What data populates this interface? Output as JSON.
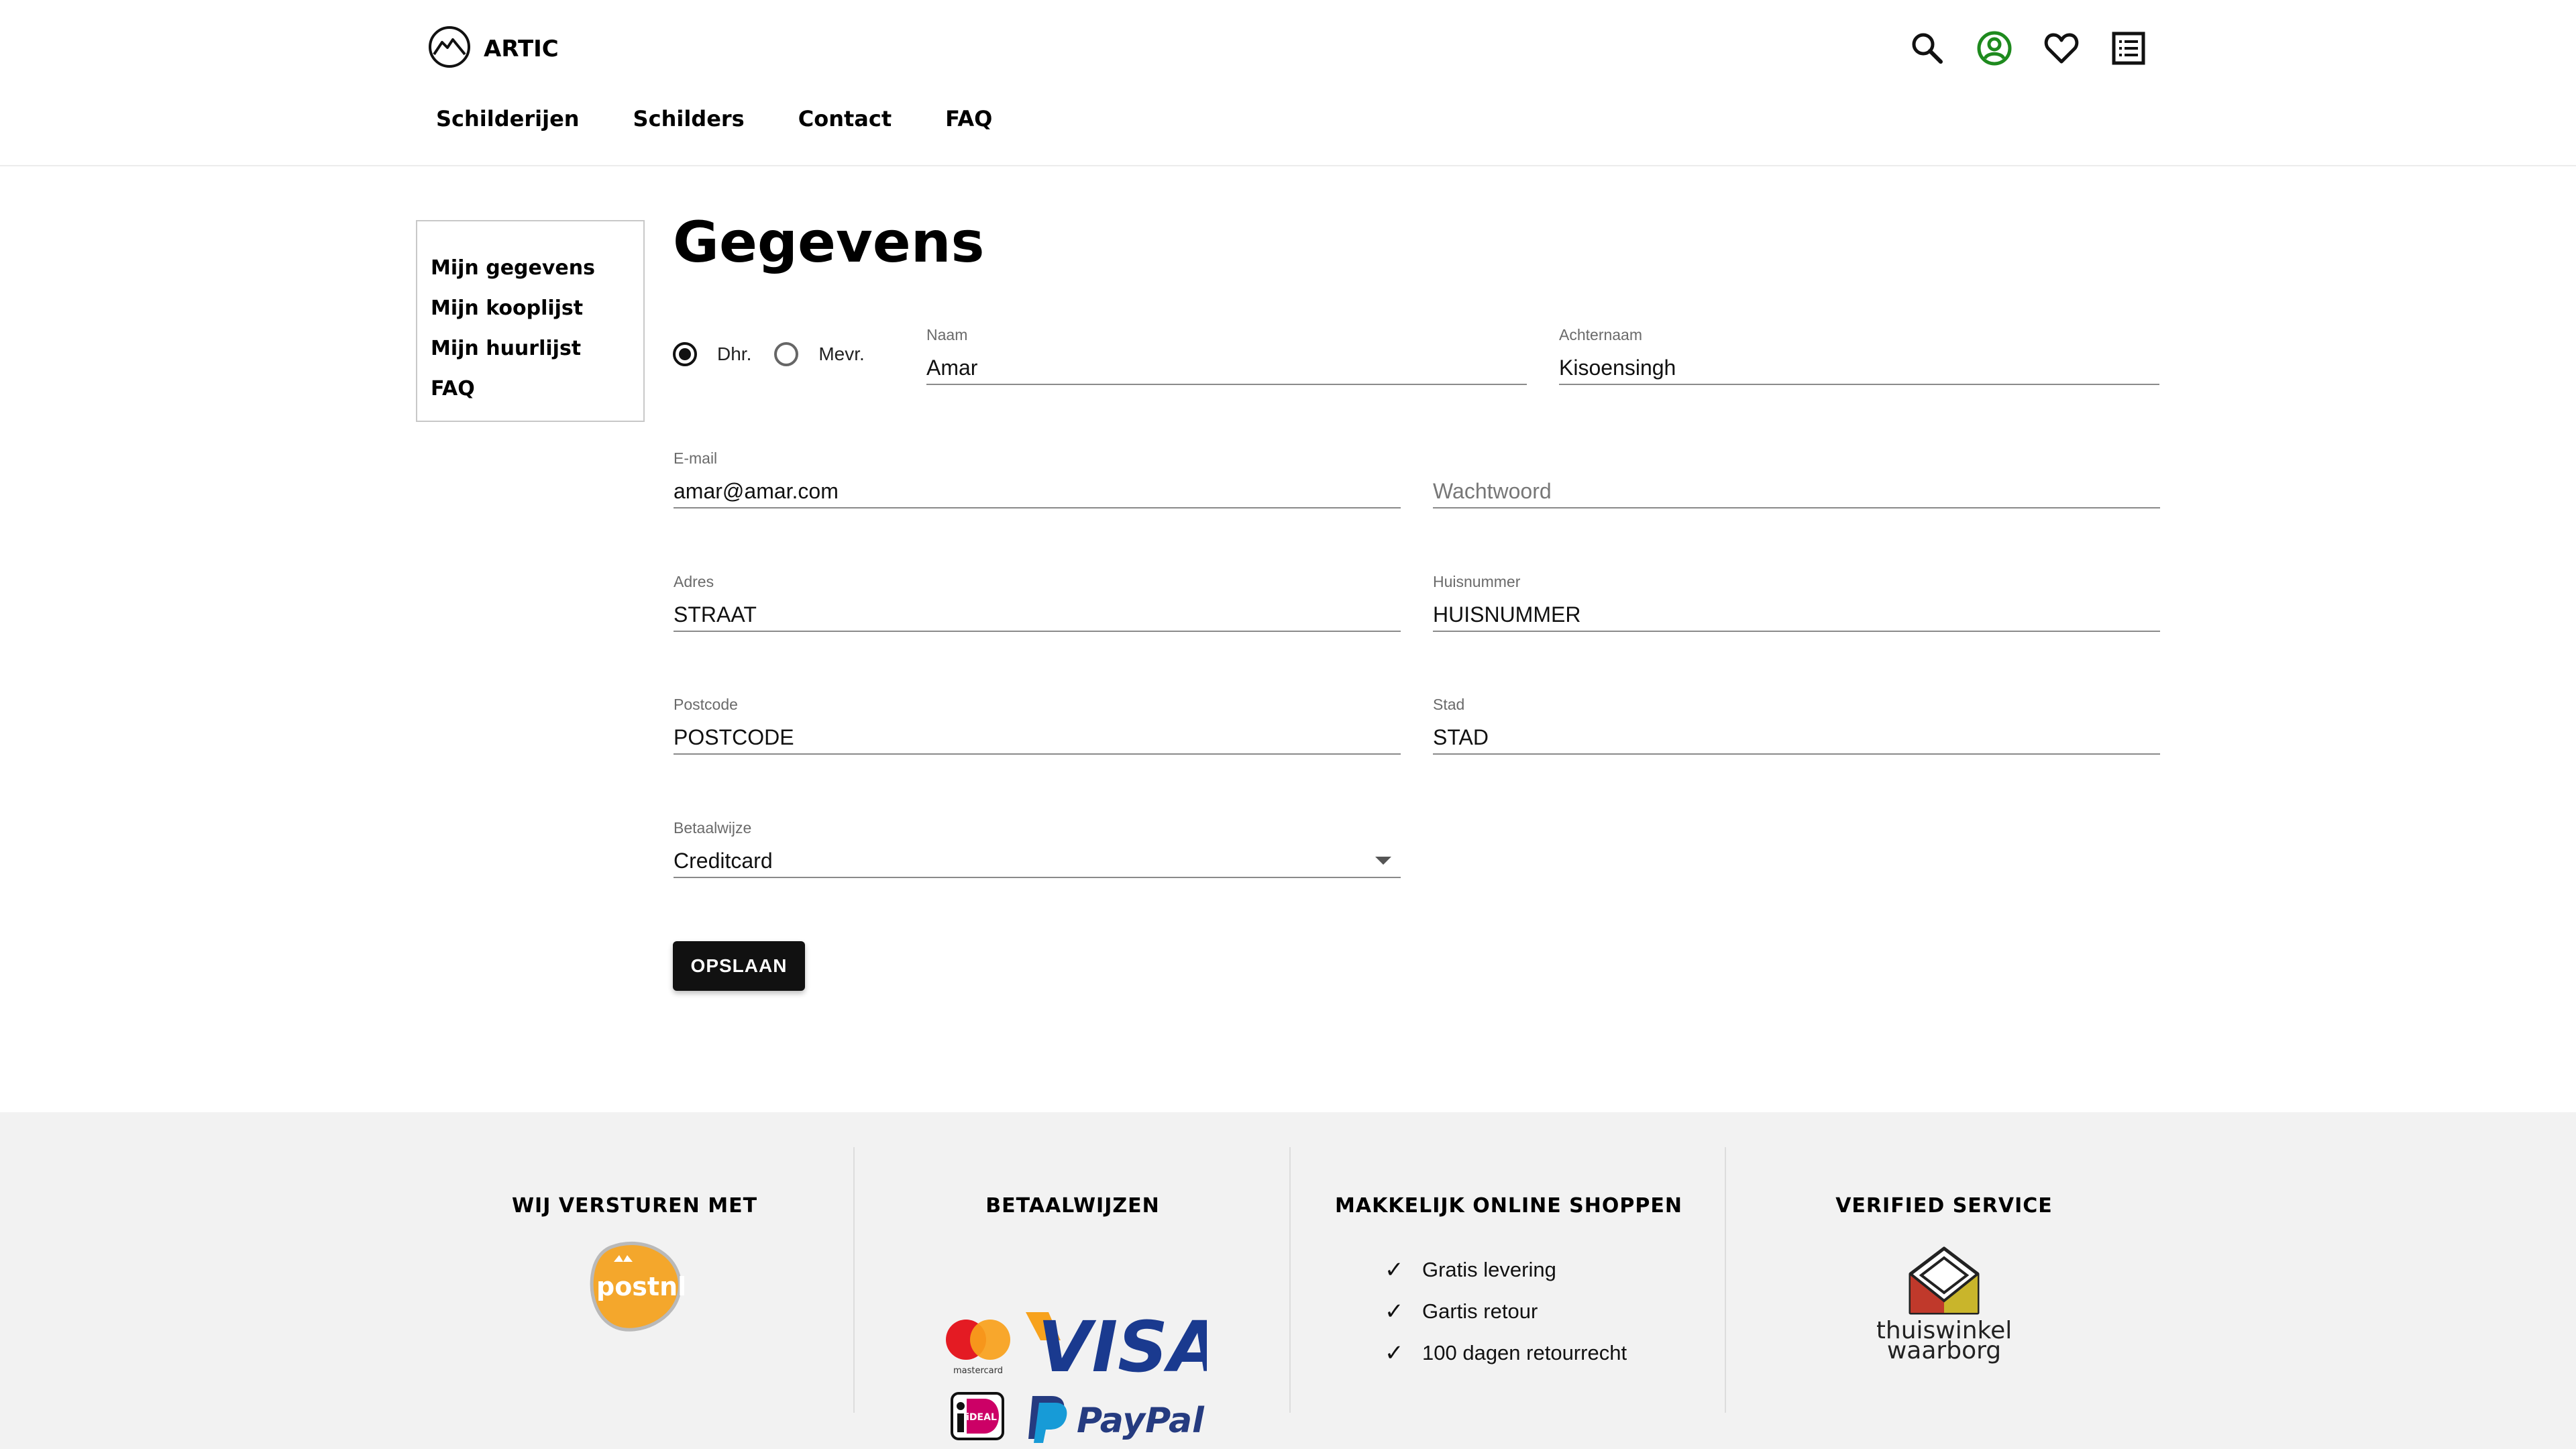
{
  "brand": {
    "name": "ARTIC",
    "logo_icon": "mountain-circle-icon"
  },
  "nav": {
    "items": [
      "Schilderijen",
      "Schilders",
      "Contact",
      "FAQ"
    ]
  },
  "header_icons": [
    {
      "name": "search-icon",
      "color": "#111111"
    },
    {
      "name": "account-icon",
      "color": "#1e8a1e"
    },
    {
      "name": "heart-icon",
      "color": "#111111"
    },
    {
      "name": "list-icon",
      "color": "#111111"
    }
  ],
  "sidebar": {
    "items": [
      "Mijn gegevens",
      "Mijn kooplijst",
      "Mijn huurlijst",
      "FAQ"
    ]
  },
  "page": {
    "title": "Gegevens"
  },
  "form": {
    "salutation": {
      "options": [
        "Dhr.",
        "Mevr."
      ],
      "selected": "Dhr."
    },
    "naam": {
      "label": "Naam",
      "value": "Amar"
    },
    "achternaam": {
      "label": "Achternaam",
      "value": "Kisoensingh"
    },
    "email": {
      "label": "E-mail",
      "value": "amar@amar.com"
    },
    "wachtwoord": {
      "placeholder": "Wachtwoord",
      "value": ""
    },
    "adres": {
      "label": "Adres",
      "value": "STRAAT"
    },
    "huisnummer": {
      "label": "Huisnummer",
      "value": "HUISNUMMER"
    },
    "postcode": {
      "label": "Postcode",
      "value": "POSTCODE"
    },
    "stad": {
      "label": "Stad",
      "value": "STAD"
    },
    "betaalwijze": {
      "label": "Betaalwijze",
      "value": "Creditcard"
    },
    "save_label": "OPSLAAN"
  },
  "footer": {
    "shipping": {
      "heading": "WIJ VERSTUREN MET",
      "logo_text": "postnl",
      "logo_icon": "postnl-logo-icon"
    },
    "payment": {
      "heading": "BETAALWIJZEN",
      "logos": [
        "mastercard",
        "VISA",
        "iDEAL",
        "PayPal"
      ]
    },
    "shopping": {
      "heading": "MAKKELIJK ONLINE SHOPPEN",
      "items": [
        "Gratis levering",
        "Gartis retour",
        "100 dagen retourrecht"
      ]
    },
    "verified": {
      "heading": "VERIFIED SERVICE",
      "logo_line1": "thuiswinkel",
      "logo_line2": "waarborg",
      "logo_icon": "thuiswinkel-waarborg-icon"
    }
  },
  "colors": {
    "accent_green": "#1e8a1e",
    "button_bg": "#111111",
    "footer_bg": "#f2f2f2"
  }
}
